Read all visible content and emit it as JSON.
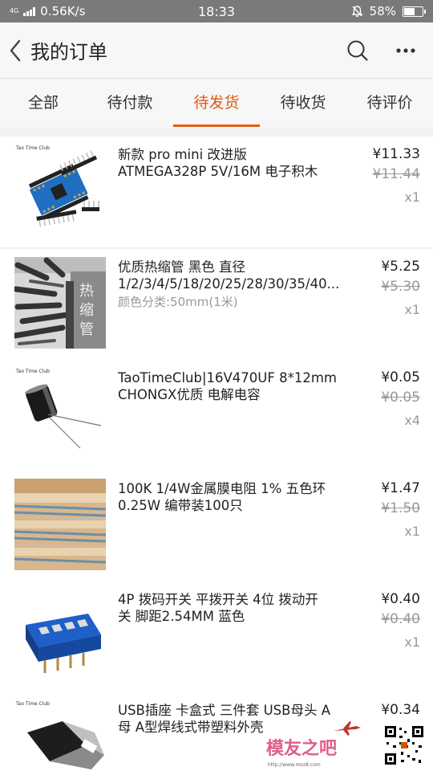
{
  "status_bar": {
    "network": "4G",
    "speed": "0.56K/s",
    "time": "18:33",
    "battery": "58%",
    "battery_level": 0.58
  },
  "header": {
    "title": "我的订单",
    "back_icon": "chevron-left-icon",
    "search_icon": "search-icon",
    "more_icon": "more-icon"
  },
  "tabs": [
    {
      "label": "全部"
    },
    {
      "label": "待付款"
    },
    {
      "label": "待发货",
      "active": true
    },
    {
      "label": "待收货"
    },
    {
      "label": "待评价"
    }
  ],
  "accent_color": "#e25a11",
  "orders": [
    {
      "name_line1": "新款  pro mini 改进版",
      "name_line2": "ATMEGA328P 5V/16M 电子积木",
      "spec": "",
      "price": "¥11.33",
      "original_price": "¥11.44",
      "quantity": "x1",
      "brand": "Tao Time Club"
    },
    {
      "name_line1": "优质热缩管 黑色 直径",
      "name_line2": "1/2/3/4/5/18/20/25/28/30/35/40...",
      "spec": "颜色分类:50mm(1米)",
      "price": "¥5.25",
      "original_price": "¥5.30",
      "quantity": "x1",
      "brand": ""
    },
    {
      "name_line1": "TaoTimeClub|16V470UF 8*12mm",
      "name_line2": "CHONGX优质 电解电容",
      "spec": "",
      "price": "¥0.05",
      "original_price": "¥0.05",
      "quantity": "x4",
      "brand": "Tao Time Club"
    },
    {
      "name_line1": "100K 1/4W金属膜电阻 1% 五色环",
      "name_line2": "0.25W 编带装100只",
      "spec": "",
      "price": "¥1.47",
      "original_price": "¥1.50",
      "quantity": "x1",
      "brand": ""
    },
    {
      "name_line1": "4P 拨码开关 平拨开关 4位 拨动开",
      "name_line2": "关 脚距2.54MM 蓝色",
      "spec": "",
      "price": "¥0.40",
      "original_price": "¥0.40",
      "quantity": "x1",
      "brand": ""
    },
    {
      "name_line1": "USB插座 卡盒式 三件套 USB母头 A",
      "name_line2": "母 A型焊线式带塑料外壳",
      "spec": "",
      "price": "¥0.34",
      "original_price": "",
      "quantity": "",
      "brand": "Tao Time Club"
    }
  ],
  "watermark": {
    "text": "模友之吧",
    "url": "http://www.moz8.com"
  }
}
